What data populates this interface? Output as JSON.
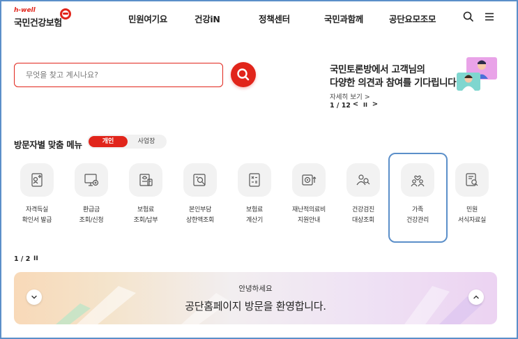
{
  "header": {
    "logo_tagline": "h-well",
    "logo_name": "국민건강보험",
    "nav": [
      "민원여기요",
      "건강iN",
      "정책센터",
      "국민과함께",
      "공단요모조모"
    ],
    "icons": [
      "search-icon",
      "menu-icon"
    ]
  },
  "search": {
    "placeholder": "무엇을 찾고 계시나요?",
    "value": ""
  },
  "notice": {
    "title_line1": "국민토론방에서 고객님의",
    "title_line2": "다양한 의견과 참여를 기다립니다.",
    "more": "자세히 보기 >",
    "pager": "1 / 12",
    "prev": "<",
    "pause": "II",
    "next": ">"
  },
  "menu": {
    "title": "방문자별 맞춤 메뉴",
    "toggle_on": "개인",
    "toggle_off": "사업장",
    "items": [
      {
        "line1": "자격득실",
        "line2": "확인서 발급",
        "icon": "certificate-icon"
      },
      {
        "line1": "환급금",
        "line2": "조회/신청",
        "icon": "refund-monitor-icon"
      },
      {
        "line1": "보험료",
        "line2": "조회/납부",
        "icon": "payment-icon"
      },
      {
        "line1": "본인부담",
        "line2": "상한액조회",
        "icon": "limit-search-icon"
      },
      {
        "line1": "보험료",
        "line2": "계산기",
        "icon": "calculator-icon"
      },
      {
        "line1": "재난적의료비",
        "line2": "지원안내",
        "icon": "medical-support-icon"
      },
      {
        "line1": "건강검진",
        "line2": "대상조회",
        "icon": "checkup-icon"
      },
      {
        "line1": "가족",
        "line2": "건강관리",
        "icon": "family-care-icon"
      },
      {
        "line1": "민원",
        "line2": "서식자료실",
        "icon": "form-library-icon"
      }
    ],
    "pager": "1 / 2",
    "pause": "II",
    "selected_index": 7
  },
  "welcome": {
    "greeting": "안녕하세요",
    "message": "공단홈페이지 방문을 환영합니다."
  },
  "colors": {
    "brand_red": "#e1251b",
    "selection_blue": "#5b8fc9",
    "icon_bg": "#f2f2f2"
  }
}
